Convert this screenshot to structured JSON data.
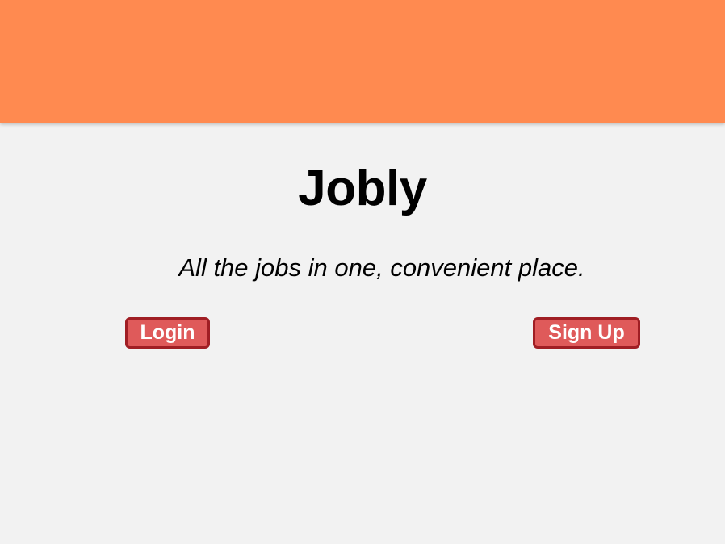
{
  "theme": {
    "navbar_color": "#ff8a50",
    "background_color": "#f2f2f2",
    "button_color": "#df5a5a",
    "button_border_color": "#a01e24"
  },
  "home": {
    "title": "Jobly",
    "tagline": "All the jobs in one, convenient place.",
    "login_label": "Login",
    "signup_label": "Sign Up"
  }
}
